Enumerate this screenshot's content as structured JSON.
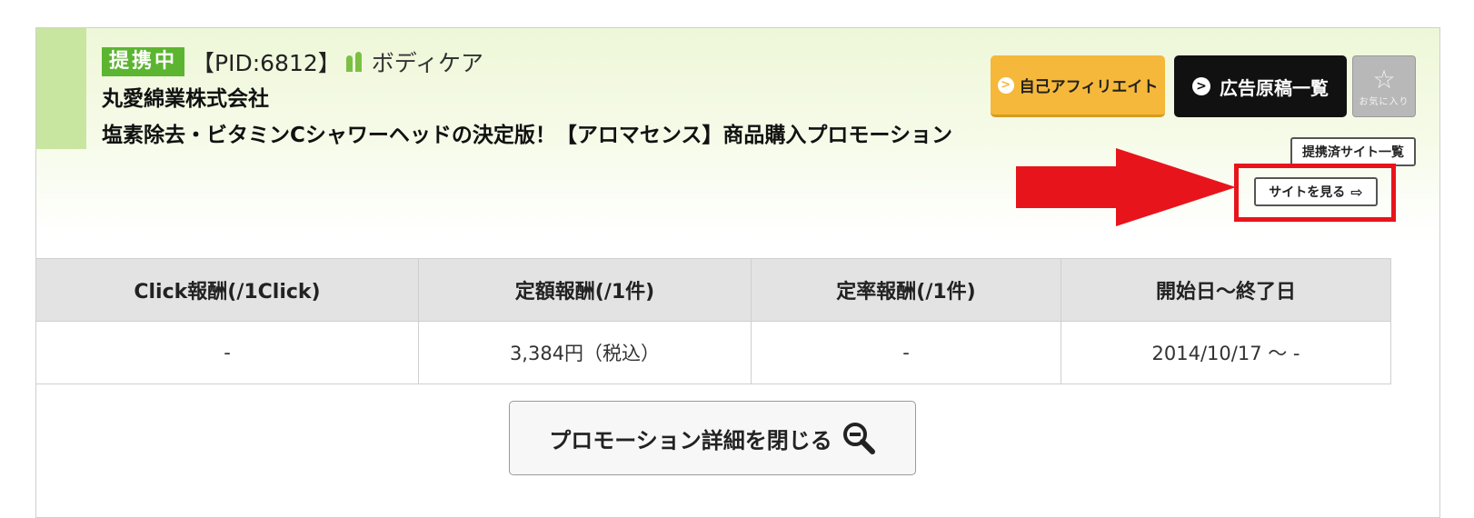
{
  "header": {
    "status_badge": "提携中",
    "pid": "【PID:6812】",
    "category": "ボディケア",
    "company": "丸愛綿業株式会社",
    "promotion_title": "塩素除去・ビタミンCシャワーヘッドの決定版！【アロマセンス】商品購入プロモーション"
  },
  "actions": {
    "self_affiliate": "自己アフィリエイト",
    "ad_list": "広告原稿一覧",
    "favorite": "お気に入り",
    "partner_sites": "提携済サイト一覧",
    "view_site": "サイトを見る"
  },
  "rates_table": {
    "headers": [
      "Click報酬(/1Click)",
      "定額報酬(/1件)",
      "定率報酬(/1件)",
      "開始日～終了日"
    ],
    "row": [
      "-",
      "3,384円（税込）",
      "-",
      "2014/10/17 ～ -"
    ]
  },
  "close_details": "プロモーション詳細を閉じる",
  "colors": {
    "badge_green": "#5cb531",
    "affiliate_orange": "#f5b83a",
    "highlight_red": "#e8141b"
  }
}
